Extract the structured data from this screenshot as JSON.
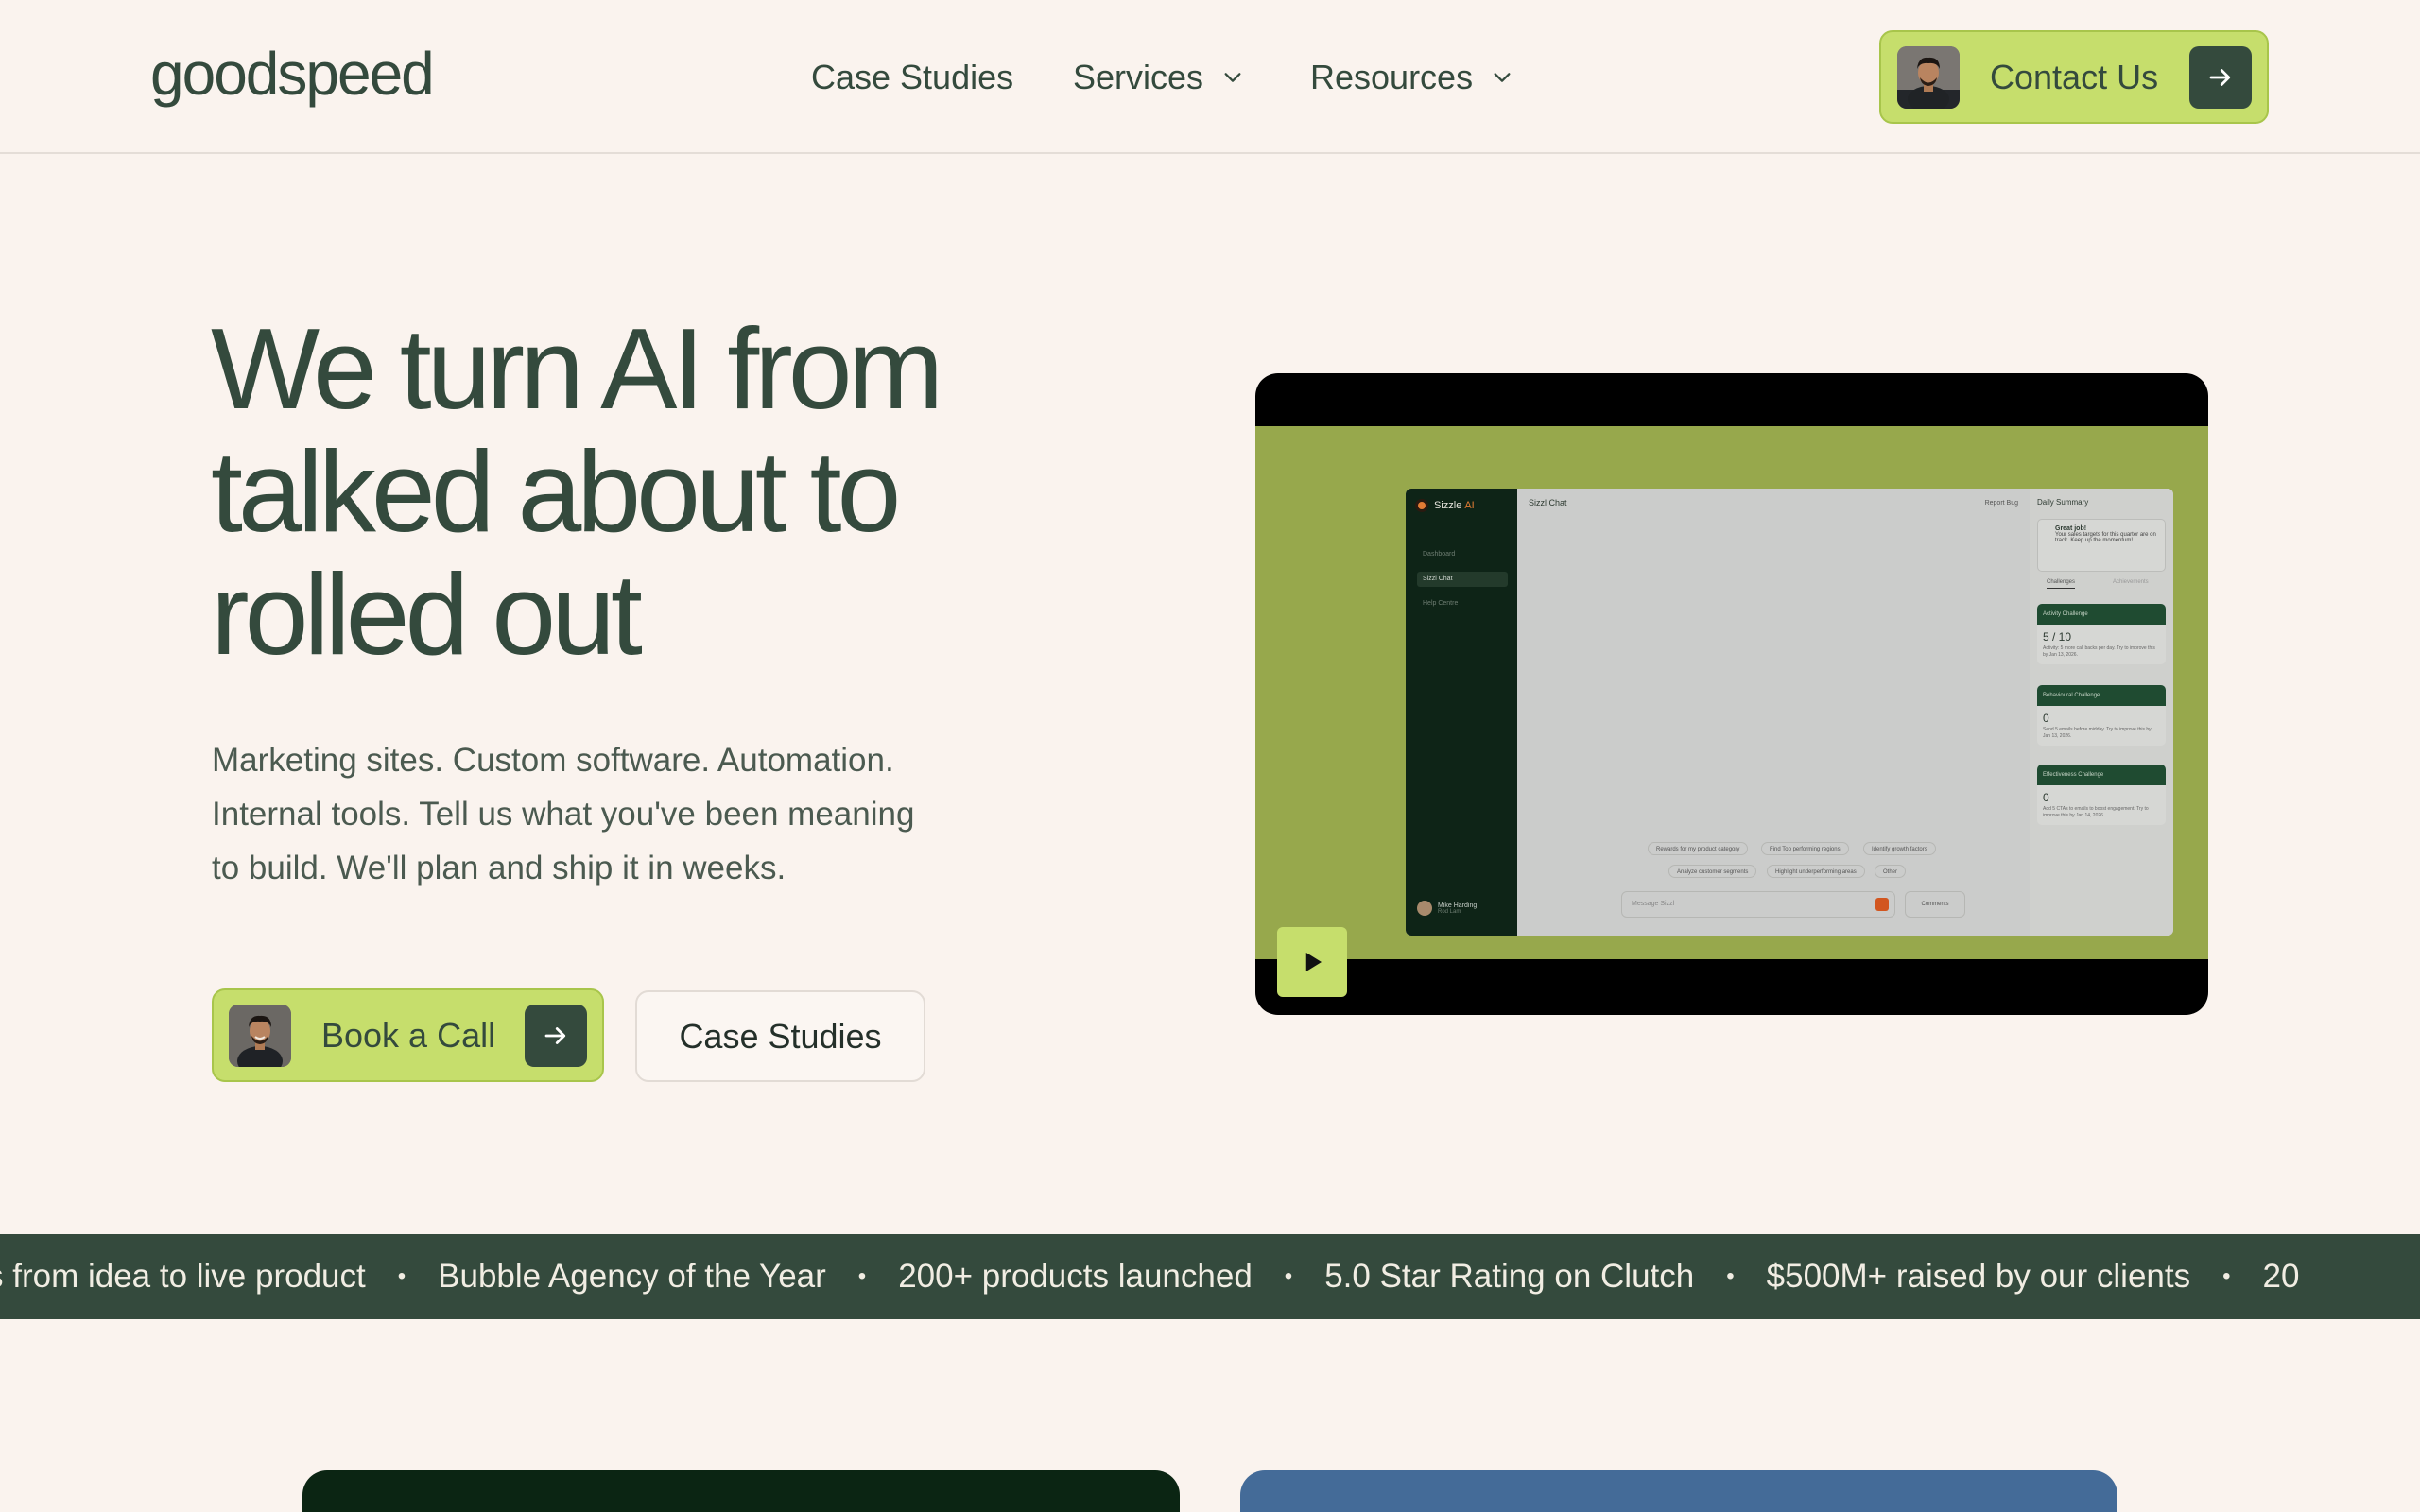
{
  "header": {
    "logo": "goodspeed",
    "nav": [
      {
        "label": "Case Studies",
        "has_dropdown": false
      },
      {
        "label": "Services",
        "has_dropdown": true
      },
      {
        "label": "Resources",
        "has_dropdown": true
      }
    ],
    "contact_label": "Contact Us"
  },
  "hero": {
    "title_lines": [
      "We turn AI from",
      "talked about to",
      "rolled out"
    ],
    "subtitle_lines": [
      "Marketing sites. Custom software. Automation.",
      "Internal tools. Tell us what you've been meaning",
      "to build. We'll plan and ship it in weeks."
    ],
    "primary_cta": "Book a Call",
    "secondary_cta": "Case Studies"
  },
  "video": {
    "app": {
      "brand": "Sizzle",
      "brand_suffix": "AI",
      "sidebar_links": [
        "Dashboard",
        "Sizzl Chat",
        "Help Centre"
      ],
      "user_name": "Mike Harding",
      "user_role": "Rod Lam",
      "chat_title": "Sizzl Chat",
      "report_bug": "Report Bug",
      "suggestions_row1": [
        "Rewards for my product category",
        "Find Top performing regions",
        "Identify growth factors"
      ],
      "suggestions_row2": [
        "Analyze customer segments",
        "Highlight underperforming areas",
        "Other"
      ],
      "message_placeholder": "Message Sizzl",
      "comments_label": "Comments",
      "summary_title": "Daily Summary",
      "great_title": "Great job!",
      "great_text": "Your sales targets for this quarter are on track. Keep up the momentum!",
      "tabs": [
        "Challenges",
        "Achievements"
      ],
      "challenges": [
        {
          "head": "Activity Challenge",
          "value": "5 / 10",
          "desc": "Activity: 5 more call backs per day. Try to improve this by Jan 13, 2026."
        },
        {
          "head": "Behavioural Challenge",
          "value": "0",
          "desc": "Send 5 emails before midday. Try to improve this by Jan 13, 2026."
        },
        {
          "head": "Effectiveness Challenge",
          "value": "0",
          "desc": "Add 5 CTAs to emails to boost engagement. Try to improve this by Jan 14, 2026."
        }
      ]
    },
    "playing": false
  },
  "marquee": {
    "items": [
      "s from idea to live product",
      "Bubble Agency of the Year",
      "200+ products launched",
      "5.0  Star Rating on Clutch",
      "$500M+ raised by our clients",
      "20"
    ],
    "separator": "•"
  },
  "colors": {
    "background": "#faf3ee",
    "primary_text": "#344a3d",
    "accent_lime": "#c6de6c",
    "dark_green": "#344a3d",
    "video_green": "#97a84c",
    "card_dark": "#0b2513",
    "card_blue": "#446b98"
  }
}
